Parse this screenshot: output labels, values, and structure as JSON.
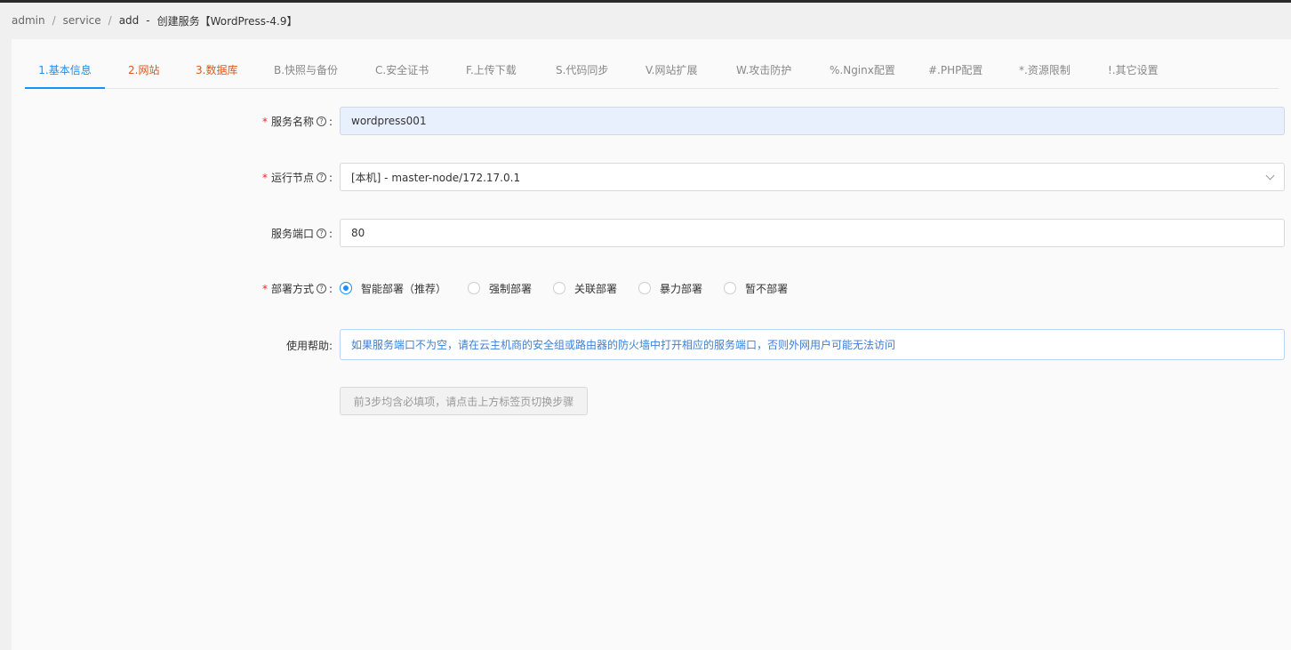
{
  "breadcrumb": {
    "items": [
      "admin",
      "service",
      "add"
    ],
    "separator": "/",
    "dash": "-",
    "title": "创建服务【WordPress-4.9】"
  },
  "tabs": [
    "1.基本信息",
    "2.网站",
    "3.数据库",
    "B.快照与备份",
    "C.安全证书",
    "F.上传下载",
    "S.代码同步",
    "V.网站扩展",
    "W.攻击防护",
    "%.Nginx配置",
    "#.PHP配置",
    "*.资源限制",
    "!.其它设置"
  ],
  "active_tab": "1.基本信息",
  "form": {
    "service_name": {
      "label": "服务名称",
      "value": "wordpress001",
      "required": true
    },
    "run_node": {
      "label": "运行节点",
      "value": "[本机] - master-node/172.17.0.1",
      "required": true
    },
    "service_port": {
      "label": "服务端口",
      "value": "80",
      "required": false
    },
    "deploy_mode": {
      "label": "部署方式",
      "required": true,
      "options": [
        "智能部署（推荐）",
        "强制部署",
        "关联部署",
        "暴力部署",
        "暂不部署"
      ],
      "selected": "智能部署（推荐）"
    },
    "help": {
      "label": "使用帮助:",
      "text": "如果服务端口不为空，请在云主机商的安全组或路由器的防火墙中打开相应的服务端口，否则外网用户可能无法访问"
    }
  },
  "submit_label": "前3步均含必填项，请点击上方标签页切换步骤",
  "colors": {
    "accent": "#1890ff",
    "required": "#f5222d",
    "tab_orange": "#e0561b",
    "help_text": "#3d7fd6"
  },
  "icons": {
    "help": "question-circle-icon",
    "select": "chevron-down-icon"
  }
}
